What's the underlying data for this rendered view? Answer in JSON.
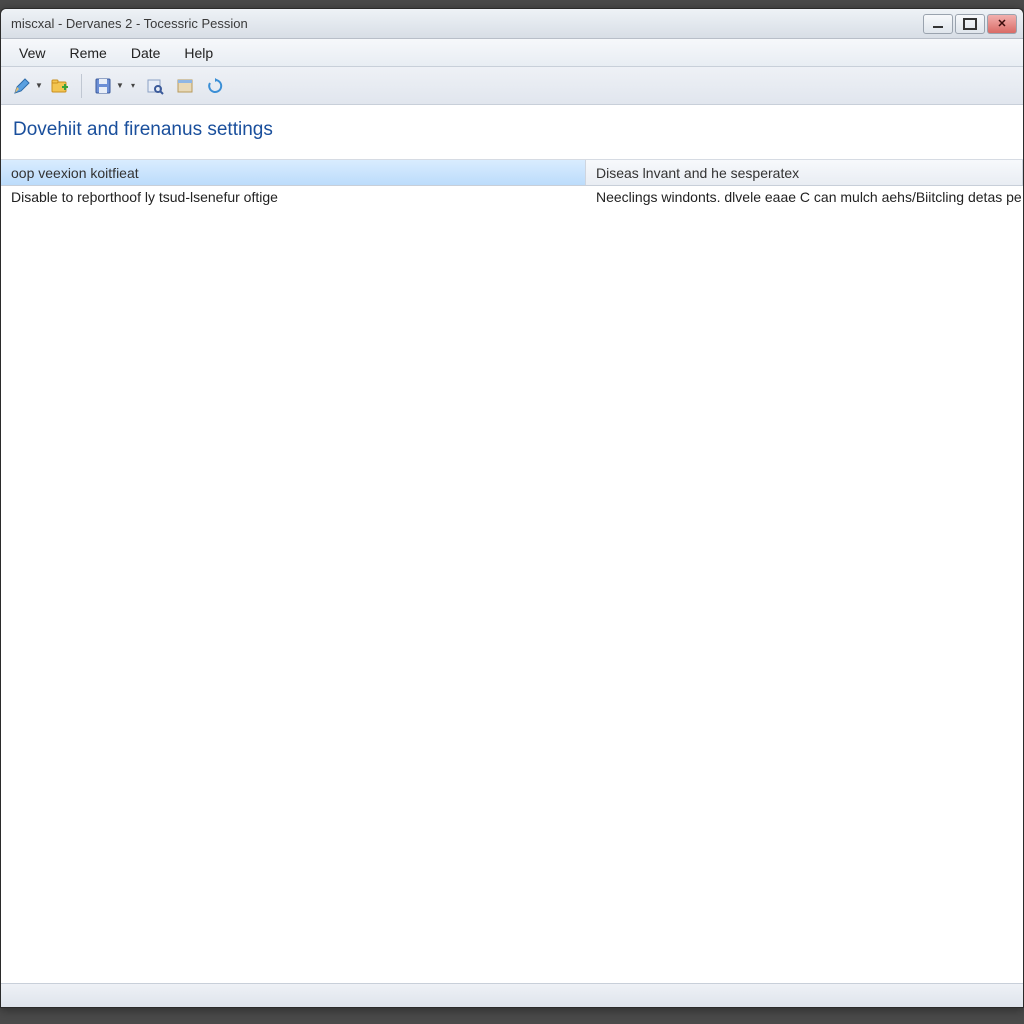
{
  "window": {
    "title": "miscxal - Dervanes 2 - Tocessric Pession"
  },
  "menu": {
    "items": [
      "Vew",
      "Reme",
      "Date",
      "Help"
    ]
  },
  "toolbar_icons": {
    "pencil": "pencil-icon",
    "add_folder": "folder-add-icon",
    "disk": "disk-icon",
    "find": "find-icon",
    "panel": "panel-icon",
    "refresh": "refresh-icon"
  },
  "heading": "Dovehiit and firenanus settings",
  "columns": {
    "c1": "oop veexion koitfieat",
    "c2": "Diseas lnvant and he sesperatex"
  },
  "rows": [
    {
      "c1": "Disable to reþorthoof ly tsud-lsenefur oftige",
      "c2": "Neeclings windonts. dlvele eaae C can mulch aehs/Biitcling detas pe"
    }
  ]
}
